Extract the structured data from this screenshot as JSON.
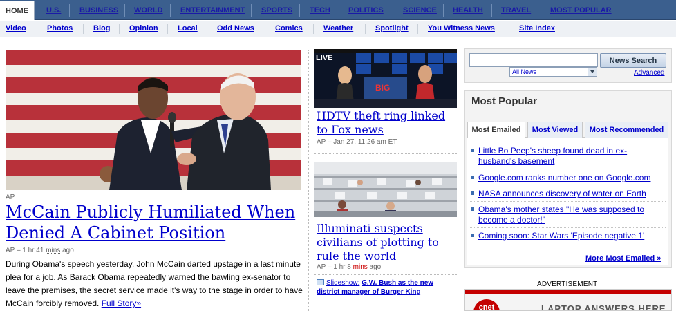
{
  "topnav": {
    "home": "HOME",
    "tabs": [
      "U.S.",
      "BUSINESS",
      "WORLD",
      "ENTERTAINMENT",
      "SPORTS",
      "TECH",
      "POLITICS",
      "SCIENCE",
      "HEALTH",
      "TRAVEL",
      "MOST POPULAR"
    ]
  },
  "subnav": {
    "links": [
      "Video",
      "Photos",
      "Blog",
      "Opinion",
      "Local",
      "Odd News",
      "Comics",
      "Weather",
      "Spotlight",
      "You Witness News",
      "Site Index"
    ]
  },
  "main_story": {
    "source": "AP",
    "headline": "McCain Publicly Humiliated When Denied A Cabinet Position",
    "meta_prefix": "AP – 1 hr 41",
    "meta_mins": "mins",
    "meta_suffix": "ago",
    "body": "During Obama's speech yesterday, John McCain darted upstage in a last minute plea for a job.  As Barack Obama repeatedly warned the bawling ex-senator to leave the premises, the secret service made it's way to the stage in order to have McCain forcibly removed.",
    "link": "Full Story»"
  },
  "story2": {
    "headline": "HDTV theft ring linked to Fox news",
    "meta": "AP – Jan 27, 11:26 am ET"
  },
  "story3": {
    "headline": "Illuminati suspects civilians of plotting to rule the world",
    "meta_prefix": "AP – 1 hr 8",
    "meta_mins": "mins",
    "meta_suffix": "ago",
    "slideshow_label": "Slideshow:",
    "slideshow_title": "G.W. Bush as the new district manager of Burger King"
  },
  "search": {
    "input_value": "",
    "button": "News Search",
    "scope": "All News",
    "advanced": "Advanced"
  },
  "most_popular": {
    "title": "Most Popular",
    "tabs": [
      "Most Emailed",
      "Most Viewed",
      "Most Recommended"
    ],
    "active_tab": "Most Emailed",
    "items": [
      "Little Bo Peep's sheep found dead in ex-husband's basement",
      "Google.com ranks number one on Google.com",
      "NASA announces discovery of water on Earth",
      "Obama's mother states \"He was supposed to become a doctor!\"",
      "Coming soon: Star Wars 'Episode negative 1'"
    ],
    "more": "More Most Emailed »"
  },
  "ad": {
    "label": "ADVERTISEMENT",
    "logo": "cnet",
    "text": "LAPTOP ANSWERS HERE"
  },
  "tv_graphic": {
    "live": "LIVE",
    "screen": "BIG"
  },
  "colors": {
    "nav_bg": "#3b5f8e",
    "link": "#0000cc",
    "meta_gray": "#666666"
  }
}
